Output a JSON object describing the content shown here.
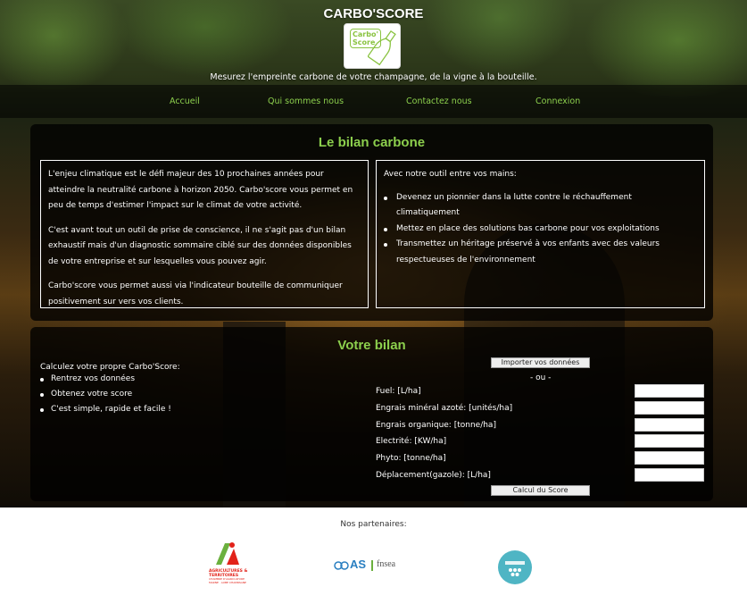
{
  "header": {
    "title": "CARBO'SCORE",
    "logo_text_1": "Carbo'",
    "logo_text_2": "Score",
    "tagline": "Mesurez l'empreinte carbone de votre champagne, de la vigne à la bouteille."
  },
  "nav": {
    "items": [
      {
        "label": "Accueil"
      },
      {
        "label": "Qui sommes nous"
      },
      {
        "label": "Contactez nous"
      },
      {
        "label": "Connexion"
      }
    ]
  },
  "bilan": {
    "title": "Le bilan carbone",
    "left_paragraphs": [
      "L'enjeu climatique est le défi majeur des 10 prochaines années pour atteindre la neutralité carbone à horizon 2050. Carbo'score vous permet en peu de temps d'estimer l'impact sur le climat de votre activité.",
      "C'est avant tout un outil de prise de conscience, il ne s'agit pas d'un bilan exhaustif mais d'un diagnostic sommaire ciblé sur des données disponibles de votre entreprise et sur lesquelles vous pouvez agir.",
      "Carbo'score vous permet aussi via l'indicateur bouteille de communiquer positivement sur vers vos clients."
    ],
    "right_intro": "Avec notre outil entre vos mains:",
    "right_items": [
      "Devenez un pionnier dans la lutte contre le réchauffement climatiquement",
      "Mettez en place des solutions bas carbone pour vos exploitations",
      "Transmettez un héritage préservé à vos enfants avec des valeurs respectueuses de l'environnement"
    ]
  },
  "votre_bilan": {
    "title": "Votre bilan",
    "intro": "Calculez votre propre Carbo'Score:",
    "steps": [
      "Rentrez vos données",
      "Obtenez votre score",
      "C'est simple, rapide et facile !"
    ],
    "import_button": "Importer vos données",
    "or_text": "- ou -",
    "fields": [
      {
        "label": "Fuel: [L/ha]",
        "value": ""
      },
      {
        "label": "Engrais minéral azoté: [unités/ha]",
        "value": ""
      },
      {
        "label": "Engrais organique: [tonne/ha]",
        "value": ""
      },
      {
        "label": "Electrité: [KW/ha]",
        "value": ""
      },
      {
        "label": "Phyto: [tonne/ha]",
        "value": ""
      },
      {
        "label": "Déplacement(gazole): [L/ha]",
        "value": ""
      }
    ],
    "calc_button": "Calcul du Score"
  },
  "partners": {
    "title": "Nos partenaires:",
    "logos": [
      {
        "name": "agricultures-territoires-logo",
        "text": "AGRICULTURES & TERRITOIRES",
        "subtext": "CHAMBRE D'AGRICULTURE MARNE · AUBE CHAMPAGNE"
      },
      {
        "name": "as-fnsea-logo",
        "text": "AS",
        "subtext": "fnsea"
      },
      {
        "name": "partner-round-logo",
        "text": ""
      }
    ]
  },
  "colors": {
    "accent": "#8ccf4d",
    "panel_bg": "rgba(0,0,0,0.78)"
  }
}
